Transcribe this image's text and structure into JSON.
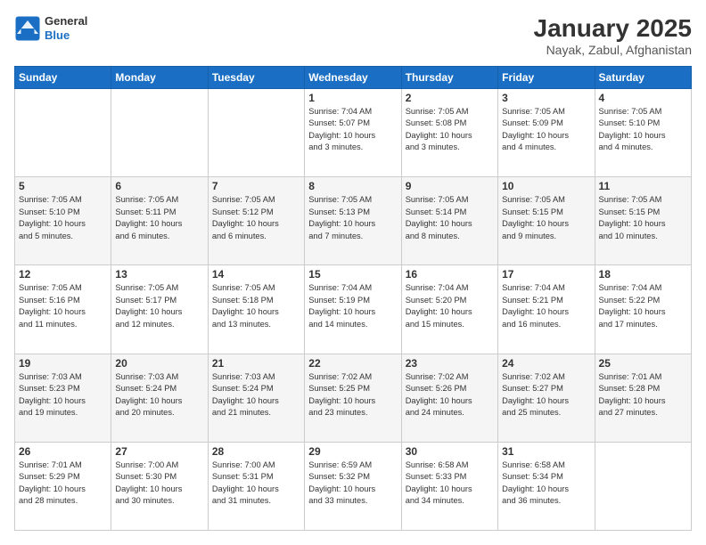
{
  "header": {
    "logo": {
      "general": "General",
      "blue": "Blue"
    },
    "title": "January 2025",
    "subtitle": "Nayak, Zabul, Afghanistan"
  },
  "days_of_week": [
    "Sunday",
    "Monday",
    "Tuesday",
    "Wednesday",
    "Thursday",
    "Friday",
    "Saturday"
  ],
  "weeks": [
    [
      {
        "day": "",
        "info": ""
      },
      {
        "day": "",
        "info": ""
      },
      {
        "day": "",
        "info": ""
      },
      {
        "day": "1",
        "info": "Sunrise: 7:04 AM\nSunset: 5:07 PM\nDaylight: 10 hours\nand 3 minutes."
      },
      {
        "day": "2",
        "info": "Sunrise: 7:05 AM\nSunset: 5:08 PM\nDaylight: 10 hours\nand 3 minutes."
      },
      {
        "day": "3",
        "info": "Sunrise: 7:05 AM\nSunset: 5:09 PM\nDaylight: 10 hours\nand 4 minutes."
      },
      {
        "day": "4",
        "info": "Sunrise: 7:05 AM\nSunset: 5:10 PM\nDaylight: 10 hours\nand 4 minutes."
      }
    ],
    [
      {
        "day": "5",
        "info": "Sunrise: 7:05 AM\nSunset: 5:10 PM\nDaylight: 10 hours\nand 5 minutes."
      },
      {
        "day": "6",
        "info": "Sunrise: 7:05 AM\nSunset: 5:11 PM\nDaylight: 10 hours\nand 6 minutes."
      },
      {
        "day": "7",
        "info": "Sunrise: 7:05 AM\nSunset: 5:12 PM\nDaylight: 10 hours\nand 6 minutes."
      },
      {
        "day": "8",
        "info": "Sunrise: 7:05 AM\nSunset: 5:13 PM\nDaylight: 10 hours\nand 7 minutes."
      },
      {
        "day": "9",
        "info": "Sunrise: 7:05 AM\nSunset: 5:14 PM\nDaylight: 10 hours\nand 8 minutes."
      },
      {
        "day": "10",
        "info": "Sunrise: 7:05 AM\nSunset: 5:15 PM\nDaylight: 10 hours\nand 9 minutes."
      },
      {
        "day": "11",
        "info": "Sunrise: 7:05 AM\nSunset: 5:15 PM\nDaylight: 10 hours\nand 10 minutes."
      }
    ],
    [
      {
        "day": "12",
        "info": "Sunrise: 7:05 AM\nSunset: 5:16 PM\nDaylight: 10 hours\nand 11 minutes."
      },
      {
        "day": "13",
        "info": "Sunrise: 7:05 AM\nSunset: 5:17 PM\nDaylight: 10 hours\nand 12 minutes."
      },
      {
        "day": "14",
        "info": "Sunrise: 7:05 AM\nSunset: 5:18 PM\nDaylight: 10 hours\nand 13 minutes."
      },
      {
        "day": "15",
        "info": "Sunrise: 7:04 AM\nSunset: 5:19 PM\nDaylight: 10 hours\nand 14 minutes."
      },
      {
        "day": "16",
        "info": "Sunrise: 7:04 AM\nSunset: 5:20 PM\nDaylight: 10 hours\nand 15 minutes."
      },
      {
        "day": "17",
        "info": "Sunrise: 7:04 AM\nSunset: 5:21 PM\nDaylight: 10 hours\nand 16 minutes."
      },
      {
        "day": "18",
        "info": "Sunrise: 7:04 AM\nSunset: 5:22 PM\nDaylight: 10 hours\nand 17 minutes."
      }
    ],
    [
      {
        "day": "19",
        "info": "Sunrise: 7:03 AM\nSunset: 5:23 PM\nDaylight: 10 hours\nand 19 minutes."
      },
      {
        "day": "20",
        "info": "Sunrise: 7:03 AM\nSunset: 5:24 PM\nDaylight: 10 hours\nand 20 minutes."
      },
      {
        "day": "21",
        "info": "Sunrise: 7:03 AM\nSunset: 5:24 PM\nDaylight: 10 hours\nand 21 minutes."
      },
      {
        "day": "22",
        "info": "Sunrise: 7:02 AM\nSunset: 5:25 PM\nDaylight: 10 hours\nand 23 minutes."
      },
      {
        "day": "23",
        "info": "Sunrise: 7:02 AM\nSunset: 5:26 PM\nDaylight: 10 hours\nand 24 minutes."
      },
      {
        "day": "24",
        "info": "Sunrise: 7:02 AM\nSunset: 5:27 PM\nDaylight: 10 hours\nand 25 minutes."
      },
      {
        "day": "25",
        "info": "Sunrise: 7:01 AM\nSunset: 5:28 PM\nDaylight: 10 hours\nand 27 minutes."
      }
    ],
    [
      {
        "day": "26",
        "info": "Sunrise: 7:01 AM\nSunset: 5:29 PM\nDaylight: 10 hours\nand 28 minutes."
      },
      {
        "day": "27",
        "info": "Sunrise: 7:00 AM\nSunset: 5:30 PM\nDaylight: 10 hours\nand 30 minutes."
      },
      {
        "day": "28",
        "info": "Sunrise: 7:00 AM\nSunset: 5:31 PM\nDaylight: 10 hours\nand 31 minutes."
      },
      {
        "day": "29",
        "info": "Sunrise: 6:59 AM\nSunset: 5:32 PM\nDaylight: 10 hours\nand 33 minutes."
      },
      {
        "day": "30",
        "info": "Sunrise: 6:58 AM\nSunset: 5:33 PM\nDaylight: 10 hours\nand 34 minutes."
      },
      {
        "day": "31",
        "info": "Sunrise: 6:58 AM\nSunset: 5:34 PM\nDaylight: 10 hours\nand 36 minutes."
      },
      {
        "day": "",
        "info": ""
      }
    ]
  ]
}
